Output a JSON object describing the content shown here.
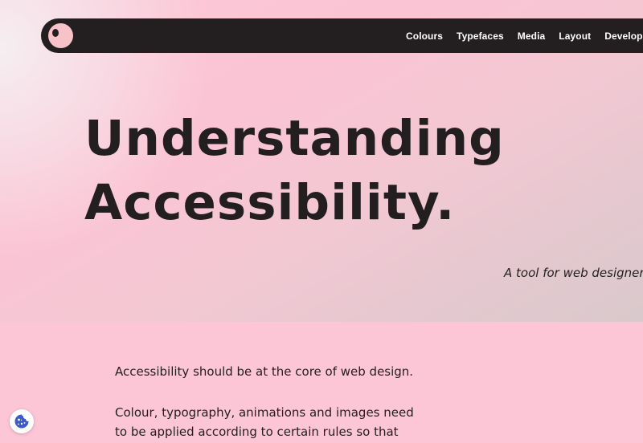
{
  "nav": {
    "links": [
      "Colours",
      "Typefaces",
      "Media",
      "Layout",
      "Development"
    ]
  },
  "hero": {
    "headline_line1": "Understanding",
    "headline_line2": "Accessibility.",
    "tagline": "A tool for web designers"
  },
  "content": {
    "paragraph1": "Accessibility should be at the core of web design.",
    "paragraph2_line1": "Colour, typography, animations and images need",
    "paragraph2_line2": "to be applied according to certain rules so that"
  },
  "icons": {
    "logo": "eye-logo-icon",
    "cookie": "cookie-icon"
  },
  "colors": {
    "nav_background": "#231f20",
    "page_pink": "#fdc6d6",
    "logo_pink": "#f7c2c8",
    "cookie_blue": "#3d5ac8"
  }
}
